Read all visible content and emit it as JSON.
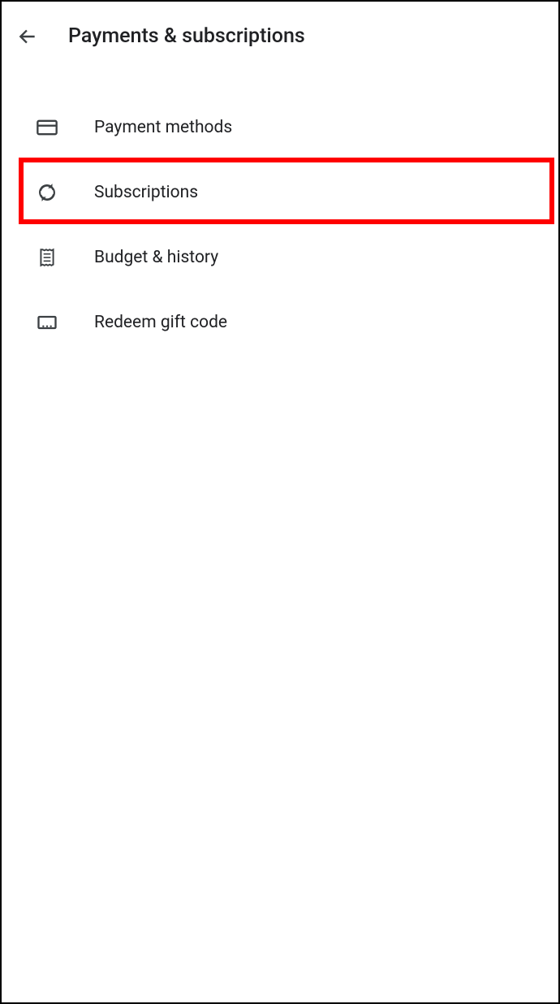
{
  "header": {
    "title": "Payments & subscriptions"
  },
  "menu": {
    "items": [
      {
        "label": "Payment methods",
        "icon": "credit-card-icon"
      },
      {
        "label": "Subscriptions",
        "icon": "refresh-icon"
      },
      {
        "label": "Budget & history",
        "icon": "receipt-icon"
      },
      {
        "label": "Redeem gift code",
        "icon": "gift-code-icon"
      }
    ]
  }
}
